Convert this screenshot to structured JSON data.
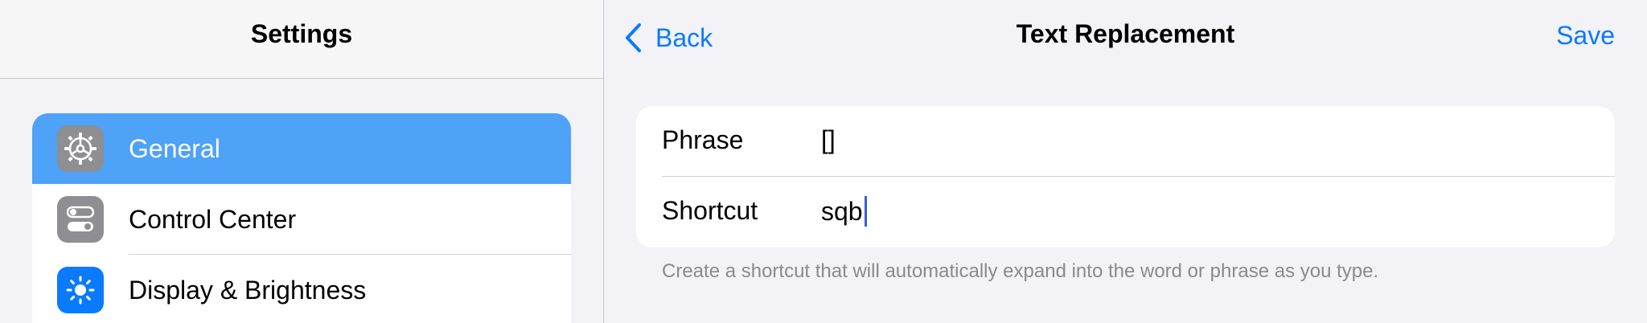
{
  "sidebar": {
    "title": "Settings",
    "items": [
      {
        "label": "General",
        "icon": "gear-icon",
        "icon_color": "#8e8e93",
        "selected": true
      },
      {
        "label": "Control Center",
        "icon": "toggles-icon",
        "icon_color": "#8e8e93",
        "selected": false
      },
      {
        "label": "Display & Brightness",
        "icon": "sun-icon",
        "icon_color": "#0a7aff",
        "selected": false
      }
    ],
    "selected_color": "#4ea2f8"
  },
  "detail": {
    "back_label": "Back",
    "title": "Text Replacement",
    "save_label": "Save",
    "form": {
      "phrase_label": "Phrase",
      "phrase_value": "[]",
      "shortcut_label": "Shortcut",
      "shortcut_value": "sqb"
    },
    "footer": "Create a shortcut that will automatically expand into the word or phrase as you type."
  },
  "accent_color": "#0a7aff"
}
